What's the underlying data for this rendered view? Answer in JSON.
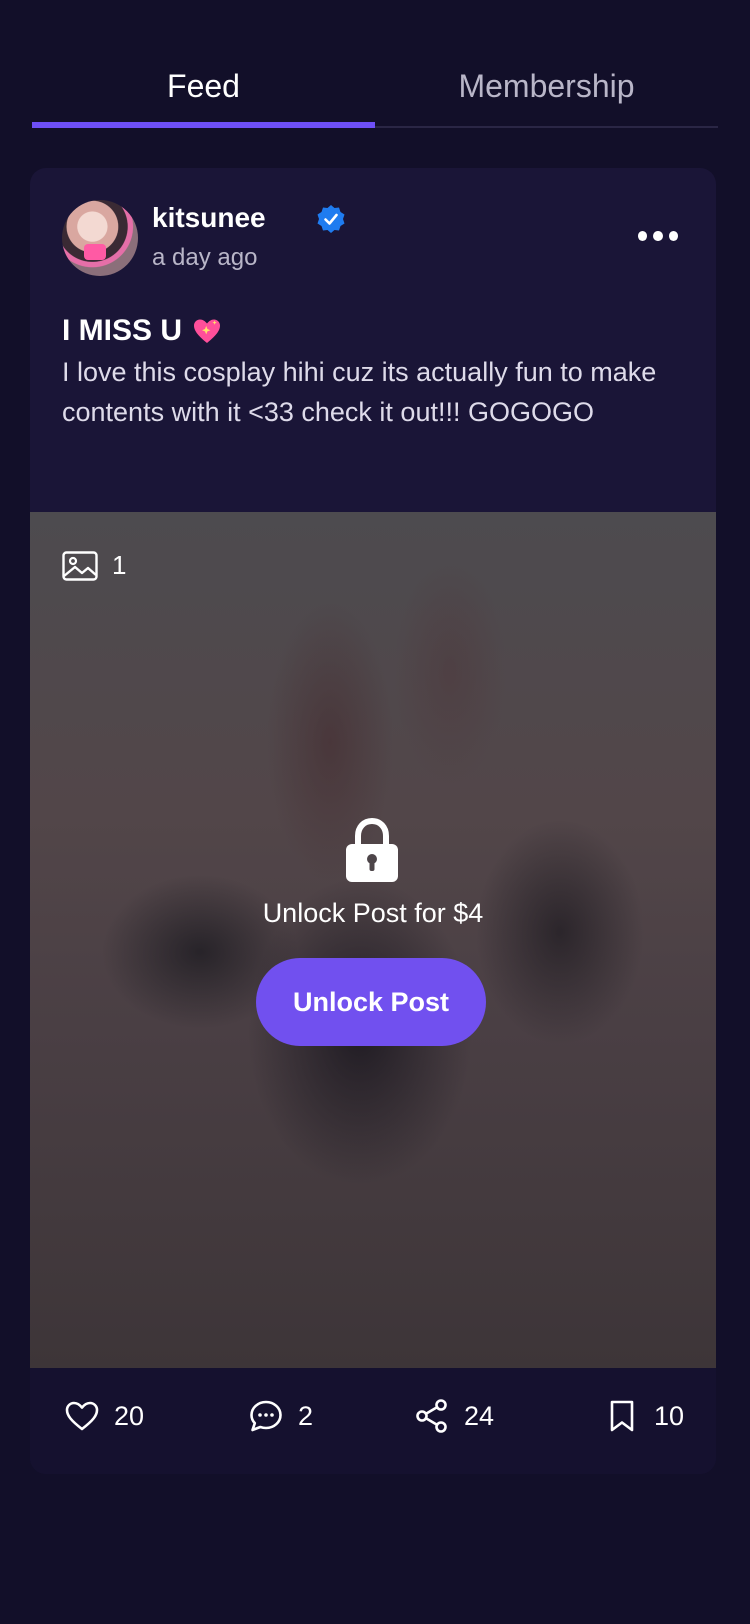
{
  "tabs": {
    "feed": "Feed",
    "membership": "Membership"
  },
  "post": {
    "username": "kitsunee",
    "timestamp": "a day ago",
    "title": "I MISS U",
    "body": "I love this cosplay hihi cuz its actually fun to make contents with it <33 check it out!!! GOGOGO",
    "media_count": "1",
    "unlock_text": "Unlock Post for $4",
    "unlock_button": "Unlock Post"
  },
  "actions": {
    "likes": "20",
    "comments": "2",
    "shares": "24",
    "bookmarks": "10"
  },
  "colors": {
    "background": "#120f29",
    "card": "#1a1537",
    "accent": "#6e4ff6",
    "verified": "#1f7cf0"
  },
  "icons": [
    "verified-icon",
    "more-icon",
    "sparkling-heart-icon",
    "image-icon",
    "lock-icon",
    "heart-icon",
    "comment-icon",
    "share-icon",
    "bookmark-icon"
  ]
}
